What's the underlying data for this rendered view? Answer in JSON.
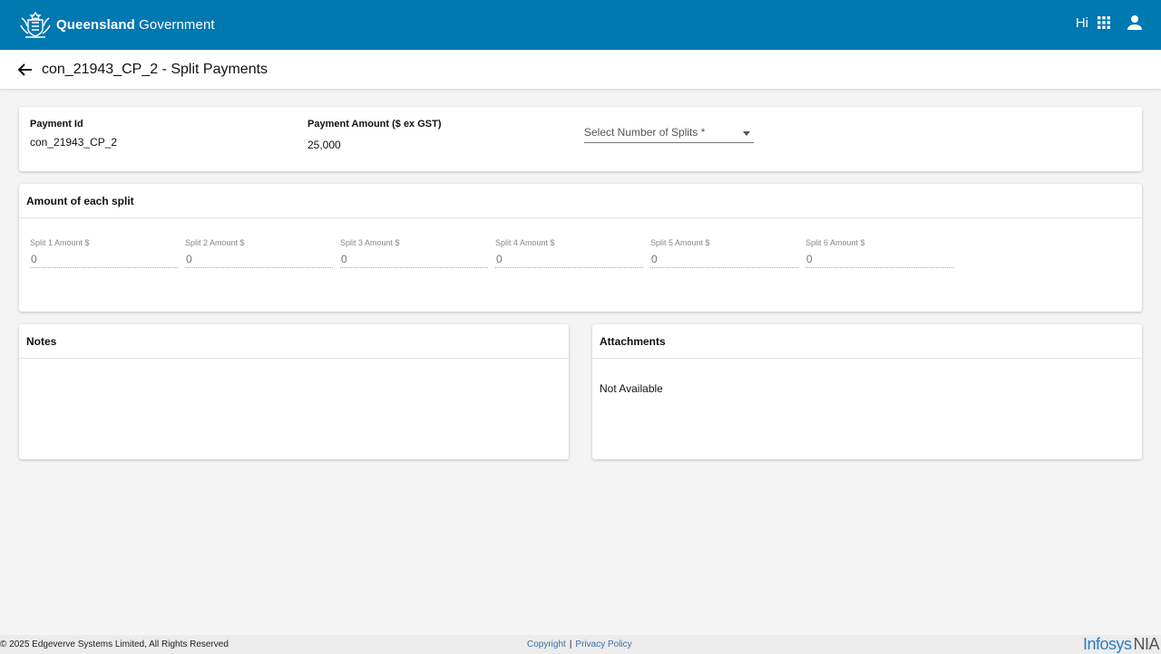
{
  "header": {
    "brand_bold": "Queensland",
    "brand_regular": "Government",
    "greeting": "Hi",
    "icons": {
      "crest": "queensland-crest-logo",
      "apps": "apps-grid-icon",
      "user": "user-account-icon"
    }
  },
  "subheader": {
    "back_icon": "arrow-back-icon",
    "title": "con_21943_CP_2 - Split Payments"
  },
  "payment": {
    "id_label": "Payment Id",
    "id_value": "con_21943_CP_2",
    "amount_label": "Payment Amount ($ ex GST)",
    "amount_value": "25,000",
    "splits_select_label": "Select Number of Splits *"
  },
  "splits": {
    "title": "Amount of each split",
    "items": [
      {
        "label": "Split 1 Amount $",
        "placeholder": "0"
      },
      {
        "label": "Split 2 Amount $",
        "placeholder": "0"
      },
      {
        "label": "Split 3 Amount $",
        "placeholder": "0"
      },
      {
        "label": "Split 4 Amount $",
        "placeholder": "0"
      },
      {
        "label": "Split 5 Amount $",
        "placeholder": "0"
      },
      {
        "label": "Split 6 Amount $",
        "placeholder": "0"
      }
    ]
  },
  "notes": {
    "title": "Notes"
  },
  "attachments": {
    "title": "Attachments",
    "empty_text": "Not Available"
  },
  "footer": {
    "copyright": "© 2025 Edgeverve Systems Limited, All Rights Reserved",
    "link_copyright": "Copyright",
    "separator": "|",
    "link_privacy": "Privacy Policy",
    "logo_main": "Infosys",
    "logo_suffix": "NIA"
  },
  "colors": {
    "header_bg": "#0078b0",
    "page_bg": "#f4f4f4",
    "link": "#3d70a8",
    "infosys_blue": "#2a7fc0"
  }
}
